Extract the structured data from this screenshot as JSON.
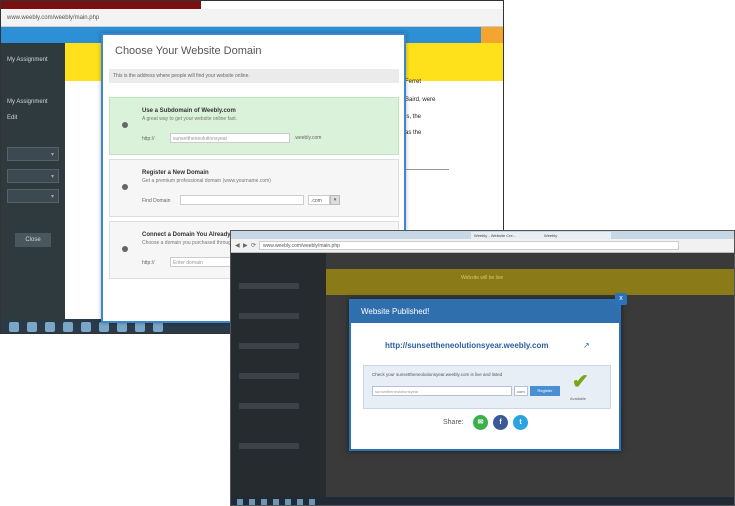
{
  "colors": {
    "blue_bar": "#2d8fd6",
    "yellow_header": "#ffe11b",
    "sidebar": "#2f3a3f",
    "selected_option": "#d9f2d9",
    "dialog_header": "#2f6fae",
    "check_green": "#7aa516",
    "share_green": "#3bb04a",
    "share_facebook": "#3b5998",
    "share_twitter": "#2aa3e0"
  },
  "shot1": {
    "url": "www.weebly.com/weebly/main.php",
    "sidebar": {
      "label_1": "My Assignment",
      "label_2": "My Assignment",
      "label_3": "Edit",
      "button": "Close"
    },
    "right_text": [
      "Ferret",
      "Baird, were",
      "ls, the",
      "as the"
    ],
    "dialog": {
      "title": "Choose Your Website Domain",
      "subtitle": "This is the address where people will find your website online.",
      "options": [
        {
          "heading": "Use a Subdomain of Weebly.com",
          "desc": "A great way to get your website online fast.",
          "field_label": "http://",
          "field_value": "sunsettheneolutionsyear",
          "suffix": ".weebly.com"
        },
        {
          "heading": "Register a New Domain",
          "desc": "Get a premium professional domain (www.yourname.com)",
          "field_label": "Find Domain",
          "field_value": "",
          "select_value": ".com",
          "select_arrow": "▾"
        },
        {
          "heading": "Connect a Domain You Already Own",
          "desc": "Choose a domain you purchased through another service",
          "field_label": "http://",
          "field_value": "Enter domain"
        }
      ]
    }
  },
  "shot2": {
    "tabs": [
      "Weebly - Website Cre...",
      "Weebly"
    ],
    "url": "www.weebly.com/weebly/main.php",
    "nav": [
      "◀",
      "▶",
      "⟳"
    ],
    "header_text": "Website will be live",
    "dialog": {
      "title": "Website Published!",
      "close": "x",
      "link": "http://sunsettheneolutionsyear.weebly.com",
      "link_icon": "↗",
      "panel_label": "Check your sunsettheneolutionsyear.weebly.com is live and listed",
      "panel_field": "sunsettheneolutionsyear",
      "panel_select": ".com",
      "panel_button": "Register",
      "check": "✔",
      "check_label": "Available",
      "share_label": "Share:",
      "share_buttons": [
        {
          "name": "email",
          "glyph": "✉"
        },
        {
          "name": "facebook",
          "glyph": "f"
        },
        {
          "name": "twitter",
          "glyph": "t"
        }
      ]
    }
  }
}
